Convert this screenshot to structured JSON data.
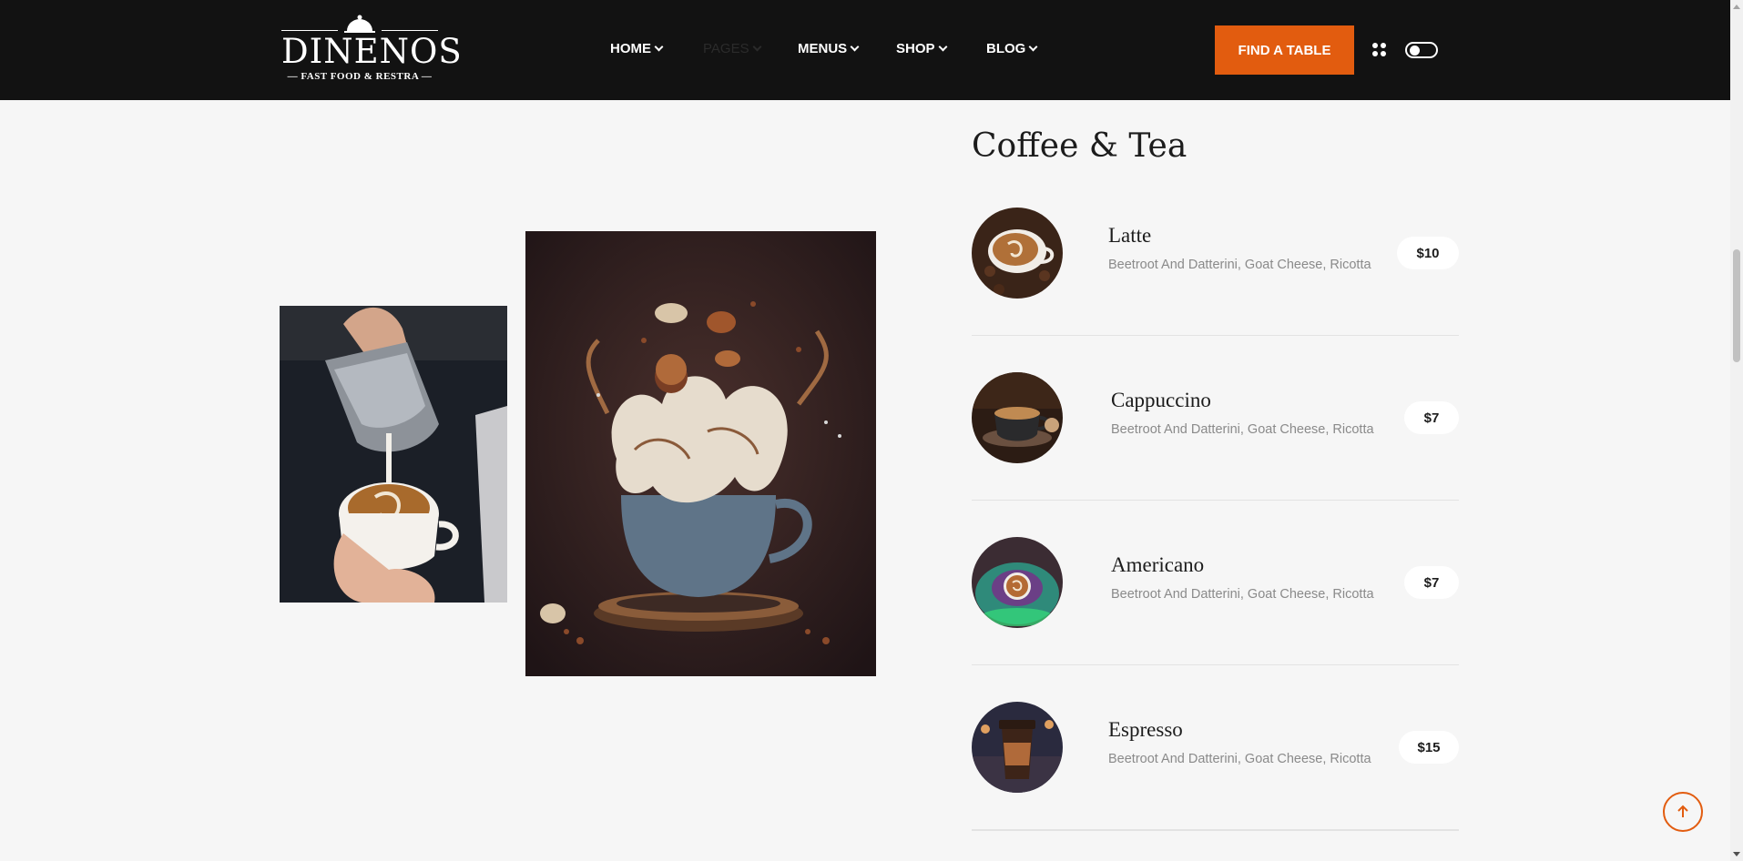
{
  "header": {
    "brand": "DINENOS",
    "tagline": "FAST FOOD & RESTRA",
    "nav": [
      {
        "label": "HOME",
        "state": "normal"
      },
      {
        "label": "PAGES",
        "state": "dim"
      },
      {
        "label": "MENUS",
        "state": "normal"
      },
      {
        "label": "SHOP",
        "state": "normal"
      },
      {
        "label": "BLOG",
        "state": "normal"
      }
    ],
    "cta_label": "FIND A TABLE",
    "icons": [
      "grid-dots-icon",
      "dark-mode-toggle"
    ]
  },
  "menu": {
    "title": "Coffee & Tea",
    "items": [
      {
        "name": "Latte",
        "description": "Beetroot And Datterini, Goat Cheese, Ricotta",
        "price": "$10"
      },
      {
        "name": "Cappuccino",
        "description": "Beetroot And Datterini, Goat Cheese, Ricotta",
        "price": "$7"
      },
      {
        "name": "Americano",
        "description": "Beetroot And Datterini, Goat Cheese, Ricotta",
        "price": "$7"
      },
      {
        "name": "Espresso",
        "description": "Beetroot And Datterini, Goat Cheese, Ricotta",
        "price": "$15"
      }
    ]
  },
  "colors": {
    "header_bg": "#121212",
    "accent": "#e25c0f",
    "page_bg": "#f6f6f6"
  }
}
